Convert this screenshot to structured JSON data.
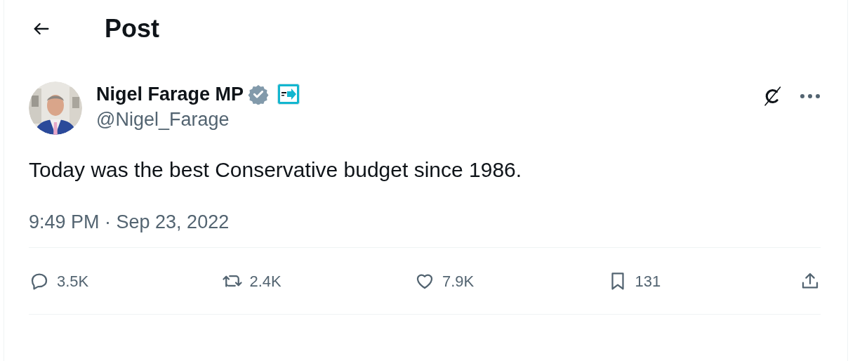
{
  "header": {
    "title": "Post"
  },
  "post": {
    "author": {
      "name": "Nigel Farage MP",
      "handle": "@Nigel_Farage",
      "verified": true
    },
    "text": "Today was the best Conservative budget since 1986.",
    "timestamp": "9:49 PM · Sep 23, 2022",
    "actions": [
      {
        "kind": "reply",
        "count": "3.5K"
      },
      {
        "kind": "repost",
        "count": "2.4K"
      },
      {
        "kind": "like",
        "count": "7.9K"
      },
      {
        "kind": "bookmark",
        "count": "131"
      },
      {
        "kind": "share"
      }
    ]
  }
}
